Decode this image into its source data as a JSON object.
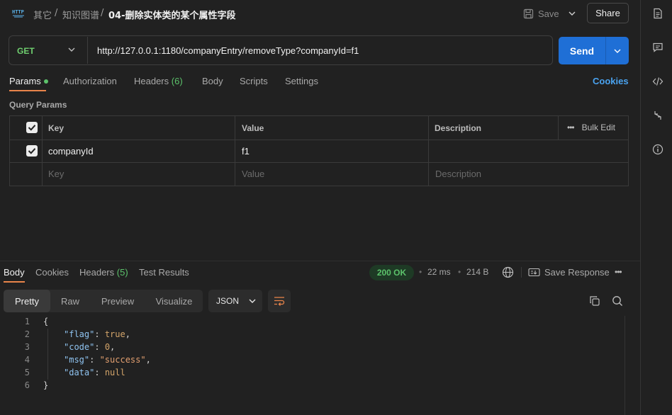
{
  "header": {
    "breadcrumb_1": "其它",
    "breadcrumb_sep": "/",
    "breadcrumb_2": "知识图谱",
    "request_name": "04-删除实体类的某个属性字段",
    "save_label": "Save",
    "share_label": "Share"
  },
  "request": {
    "method": "GET",
    "url": "http://127.0.0.1:1180/companyEntry/removeType?companyId=f1",
    "send_label": "Send"
  },
  "request_tabs": [
    {
      "label": "Params",
      "count": ""
    },
    {
      "label": "Authorization",
      "count": ""
    },
    {
      "label": "Headers",
      "count": "(6)"
    },
    {
      "label": "Body",
      "count": ""
    },
    {
      "label": "Scripts",
      "count": ""
    },
    {
      "label": "Settings",
      "count": ""
    }
  ],
  "cookies_label": "Cookies",
  "query_params": {
    "title": "Query Params",
    "headers": {
      "key": "Key",
      "value": "Value",
      "description": "Description",
      "bulk_edit": "Bulk Edit"
    },
    "rows": [
      {
        "checked": true,
        "key": "companyId",
        "value": "f1",
        "description": ""
      }
    ],
    "placeholder": {
      "key": "Key",
      "value": "Value",
      "description": "Description"
    }
  },
  "response": {
    "tabs": [
      {
        "label": "Body",
        "count": ""
      },
      {
        "label": "Cookies",
        "count": ""
      },
      {
        "label": "Headers",
        "count": "(5)"
      },
      {
        "label": "Test Results",
        "count": ""
      }
    ],
    "status": "200 OK",
    "time": "22 ms",
    "size": "214 B",
    "save_response": "Save Response",
    "formats": [
      "Pretty",
      "Raw",
      "Preview",
      "Visualize"
    ],
    "language": "JSON",
    "code_lines": [
      {
        "n": "1",
        "text": "{"
      },
      {
        "n": "2",
        "text": "\"flag\": true,"
      },
      {
        "n": "3",
        "text": "\"code\": 0,"
      },
      {
        "n": "4",
        "text": "\"msg\": \"success\","
      },
      {
        "n": "5",
        "text": "\"data\": null"
      },
      {
        "n": "6",
        "text": "}"
      }
    ]
  },
  "colors": {
    "accent_tab": "#e8844a",
    "send": "#1f6fd6",
    "ok": "#5cc26b",
    "get": "#6fcf6f",
    "link": "#4aa3f0"
  },
  "icons": [
    "http-icon",
    "save-icon",
    "chevron-down-icon",
    "document-icon",
    "comment-icon",
    "code-icon",
    "sync-icon",
    "info-icon",
    "globe-icon",
    "save-response-icon",
    "more-icon",
    "wrap-lines-icon",
    "copy-icon",
    "search-icon"
  ]
}
